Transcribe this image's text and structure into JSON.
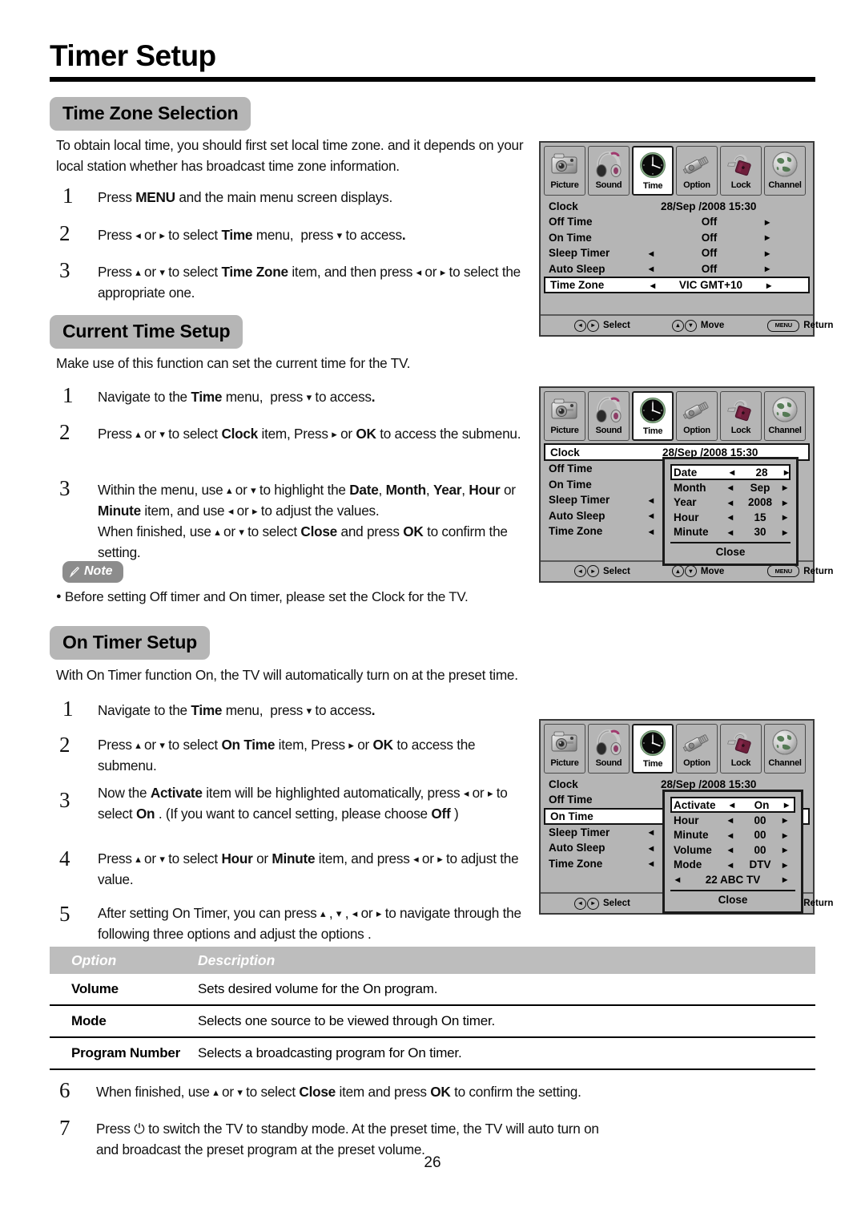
{
  "page": {
    "title": "Timer Setup",
    "number": "26"
  },
  "sections": {
    "time_zone": {
      "heading": "Time Zone Selection",
      "intro": "To obtain local time, you should first set local time zone. and it depends on your local station whether has broadcast time zone information.",
      "steps": [
        {
          "num": "1",
          "text": "Press <b>MENU</b> and the main menu screen displays."
        },
        {
          "num": "2",
          "text": "Press <span class=\"ar\">◂</span> or <span class=\"ar\">▸</span> to select <b>Time</b> menu,&nbsp; press <span class=\"ar\">▾</span> to access<b>.</b>"
        },
        {
          "num": "3",
          "text": "Press <span class=\"ar\">▴</span> or <span class=\"ar\">▾</span> to select <b>Time Zone</b> item, and then press <span class=\"ar\">◂</span> or <span class=\"ar\">▸</span> to select the appropriate one."
        }
      ]
    },
    "current_time": {
      "heading": "Current Time Setup",
      "intro": "Make use of this function can set the current time for the TV.",
      "steps": [
        {
          "num": "1",
          "text": "Navigate to the <b>Time</b> menu,&nbsp; press <span class=\"ar\">▾</span> to access<b>.</b>"
        },
        {
          "num": "2",
          "text": "Press <span class=\"ar\">▴</span> or <span class=\"ar\">▾</span> to select <b>Clock</b> item, Press <span class=\"ar\">▸</span> or <b>OK</b> to access the submenu."
        },
        {
          "num": "3",
          "text": "Within the menu, use <span class=\"ar\">▴</span> or <span class=\"ar\">▾</span> to highlight the <b>Date</b>, <b>Month</b>, <b>Year</b>, <b>Hour</b> or <b>Minute</b> item, and use <span class=\"ar\">◂</span> or <span class=\"ar\">▸</span> to adjust the values.<br>When finished, use <span class=\"ar\">▴</span> or <span class=\"ar\">▾</span> to select <b>Close</b> and press <b>OK</b> to confirm the setting."
        }
      ]
    },
    "note": {
      "label": "Note",
      "icon": "pencil-icon",
      "bullet": "●",
      "text": "Before setting Off timer and On timer, please set the Clock for the TV."
    },
    "on_timer": {
      "heading": "On Timer Setup",
      "intro": "With On Timer function On, the TV will automatically turn on at the preset time.",
      "steps": [
        {
          "num": "1",
          "text": "Navigate to the <b>Time</b> menu,&nbsp; press <span class=\"ar\">▾</span> to access<b>.</b>"
        },
        {
          "num": "2",
          "text": "Press <span class=\"ar\">▴</span> or <span class=\"ar\">▾</span> to select <b>On Time</b> item, Press <span class=\"ar\">▸</span> or <b>OK</b> to access the submenu."
        },
        {
          "num": "3",
          "text": "Now the <b>Activate</b> item will be highlighted automatically, press <span class=\"ar\">◂</span> or <span class=\"ar\">▸</span> to select <b>On</b> . (If you want to cancel setting, please choose <b>Off</b> )"
        },
        {
          "num": "4",
          "text": "Press <span class=\"ar\">▴</span> or <span class=\"ar\">▾</span> to select <b>Hour</b> or <b>Minute</b> item, and press <span class=\"ar\">◂</span> or <span class=\"ar\">▸</span> to adjust the value."
        },
        {
          "num": "5",
          "text": "After setting On Timer, you can press <span class=\"ar\">▴</span> , <span class=\"ar\">▾</span> , <span class=\"ar\">◂</span> or <span class=\"ar\">▸</span> to navigate through the following three options and adjust the options ."
        }
      ],
      "steps_after_table": [
        {
          "num": "6",
          "text": "When finished, use <span class=\"ar\">▴</span> or <span class=\"ar\">▾</span> to select <b>Close</b> item and press <b>OK</b> to confirm the setting."
        },
        {
          "num": "7",
          "text": "Press ⏻ to switch the TV to standby mode. At the preset time, the TV will auto turn on and broadcast the preset program at the preset volume."
        }
      ]
    }
  },
  "option_table": {
    "headers": [
      "Option",
      "Description"
    ],
    "rows": [
      {
        "option": "Volume",
        "description": "Sets desired volume for the On program."
      },
      {
        "option": "Mode",
        "description": "Selects one source to be viewed through On timer."
      },
      {
        "option": "Program Number",
        "description": "Selects a broadcasting program for On timer."
      }
    ]
  },
  "osd": {
    "tabs": [
      {
        "label": "Picture",
        "icon": "camera-icon",
        "active": false
      },
      {
        "label": "Sound",
        "icon": "headphones-icon",
        "active": false
      },
      {
        "label": "Time",
        "icon": "clock-icon",
        "active": true
      },
      {
        "label": "Option",
        "icon": "connector-icon",
        "active": false
      },
      {
        "label": "Lock",
        "icon": "padlock-icon",
        "active": false
      },
      {
        "label": "Channel",
        "icon": "globe-icon",
        "active": false
      }
    ],
    "footer": [
      {
        "keys": "◂▸",
        "label": "Select"
      },
      {
        "keys": "▴▾",
        "label": "Move"
      },
      {
        "keys": "MENU",
        "label": "Return"
      }
    ],
    "clock_value": "28/Sep  /2008 15:30",
    "screen1": {
      "rows": [
        {
          "label": "Clock",
          "value": "28/Sep  /2008 15:30",
          "left": false,
          "right": false,
          "selected": false,
          "clock": true
        },
        {
          "label": "Off Time",
          "value": "Off",
          "left": false,
          "right": true,
          "selected": false
        },
        {
          "label": "On Time",
          "value": "Off",
          "left": false,
          "right": true,
          "selected": false
        },
        {
          "label": "Sleep Timer",
          "value": "Off",
          "left": true,
          "right": true,
          "selected": false
        },
        {
          "label": "Auto Sleep",
          "value": "Off",
          "left": true,
          "right": true,
          "selected": false
        },
        {
          "label": "Time Zone",
          "value": "VIC GMT+10",
          "left": true,
          "right": true,
          "selected": true
        }
      ]
    },
    "screen2": {
      "rows": [
        {
          "label": "Clock",
          "value": "28/Sep  /2008 15:30",
          "left": false,
          "right": false,
          "selected": true,
          "clock": true
        },
        {
          "label": "Off Time",
          "value": "",
          "left": false,
          "right": false,
          "selected": false
        },
        {
          "label": "On Time",
          "value": "",
          "left": false,
          "right": false,
          "selected": false
        },
        {
          "label": "Sleep Timer",
          "value": "",
          "left": true,
          "right": false,
          "selected": false
        },
        {
          "label": "Auto Sleep",
          "value": "",
          "left": true,
          "right": false,
          "selected": false
        },
        {
          "label": "Time Zone",
          "value": "",
          "left": true,
          "right": false,
          "selected": false
        }
      ],
      "popup": {
        "items": [
          {
            "label": "Date",
            "value": "28",
            "selected": true
          },
          {
            "label": "Month",
            "value": "Sep",
            "selected": false
          },
          {
            "label": "Year",
            "value": "2008",
            "selected": false
          },
          {
            "label": "Hour",
            "value": "15",
            "selected": false
          },
          {
            "label": "Minute",
            "value": "30",
            "selected": false
          }
        ],
        "close": "Close"
      }
    },
    "screen3": {
      "rows": [
        {
          "label": "Clock",
          "value": "28/Sep  /2008 15:30",
          "left": false,
          "right": false,
          "selected": false,
          "clock": true
        },
        {
          "label": "Off Time",
          "value": "",
          "left": false,
          "right": false,
          "selected": false
        },
        {
          "label": "On Time",
          "value": "",
          "left": false,
          "right": false,
          "selected": true
        },
        {
          "label": "Sleep Timer",
          "value": "",
          "left": true,
          "right": false,
          "selected": false
        },
        {
          "label": "Auto Sleep",
          "value": "",
          "left": true,
          "right": false,
          "selected": false
        },
        {
          "label": "Time Zone",
          "value": "",
          "left": true,
          "right": false,
          "selected": false
        }
      ],
      "popup": {
        "items": [
          {
            "label": "Activate",
            "value": "On",
            "selected": true
          },
          {
            "label": "Hour",
            "value": "00",
            "selected": false
          },
          {
            "label": "Minute",
            "value": "00",
            "selected": false
          },
          {
            "label": "Volume",
            "value": "00",
            "selected": false
          },
          {
            "label": "Mode",
            "value": "DTV",
            "selected": false
          }
        ],
        "program": "22 ABC TV",
        "close": "Close"
      }
    }
  },
  "colors": {
    "pill_bg": "#b6b6b6",
    "note_bg": "#8c8c8c",
    "osd_bg": "#b5b5b5",
    "table_head_bg": "#bdbdbd",
    "rule": "#000000"
  }
}
